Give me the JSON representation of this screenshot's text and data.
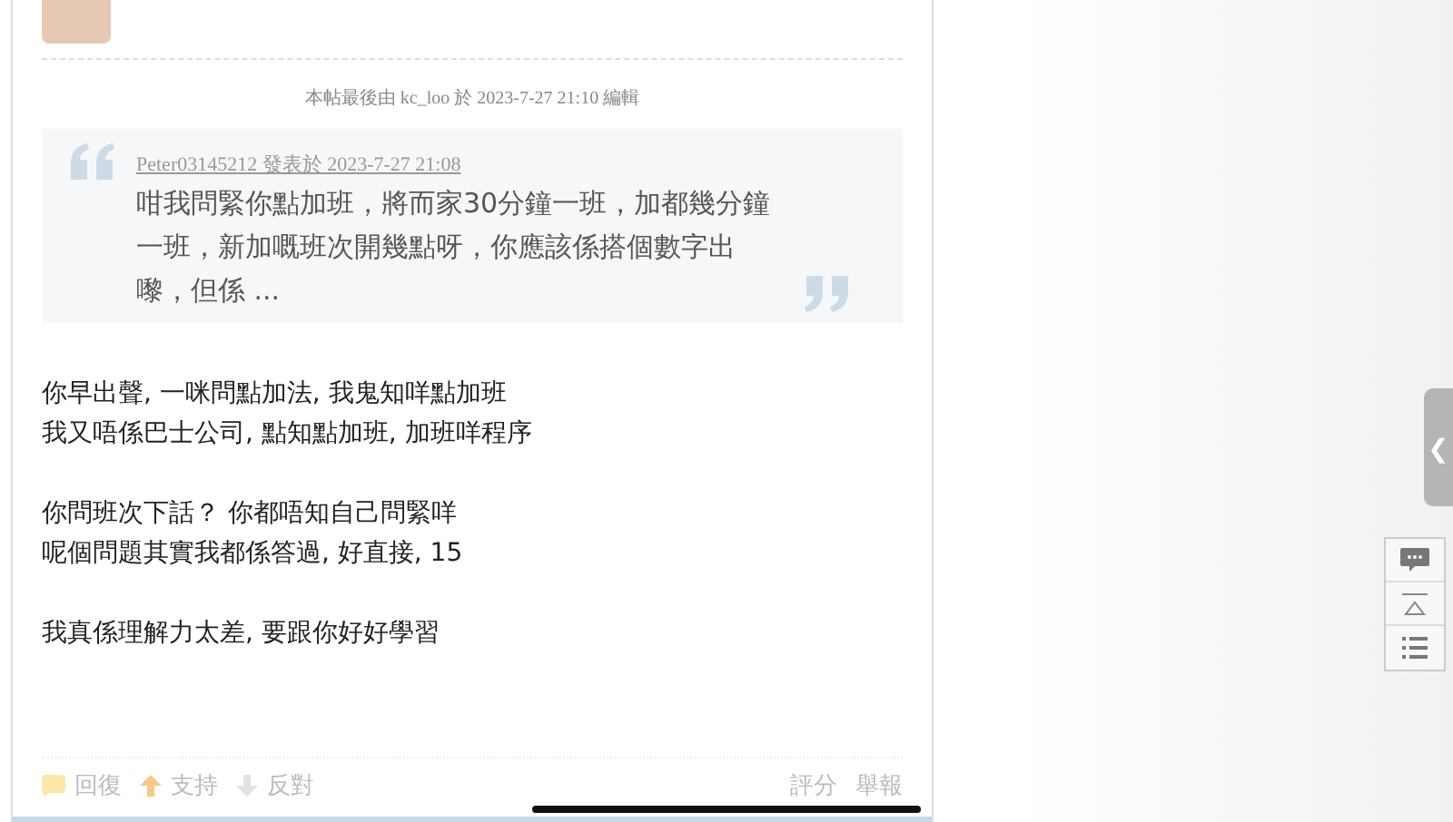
{
  "edit_note": "本帖最後由 kc_loo 於 2023-7-27 21:10 編輯",
  "quote": {
    "author_line": "Peter03145212 發表於 2023-7-27 21:08",
    "text": "咁我問緊你點加班，將而家30分鐘一班，加都幾分鐘一班，新加嘅班次開幾點呀，你應該係搭個數字出嚟，但係 ..."
  },
  "body": [
    [
      "你早出聲, 一咪問點加法, 我鬼知咩點加班",
      "我又唔係巴士公司, 點知點加班, 加班咩程序"
    ],
    [
      "你問班次下話？ 你都唔知自己問緊咩",
      "呢個問題其實我都係答過, 好直接, 15"
    ],
    [
      "我真係理解力太差, 要跟你好好學習"
    ]
  ],
  "actions": [
    {
      "kind": "reply",
      "label": "回復"
    },
    {
      "kind": "support",
      "label": "支持"
    },
    {
      "kind": "oppose",
      "label": "反對"
    }
  ],
  "right_actions": [
    "評分",
    "舉報"
  ],
  "side_tab": {
    "label": "❮"
  }
}
